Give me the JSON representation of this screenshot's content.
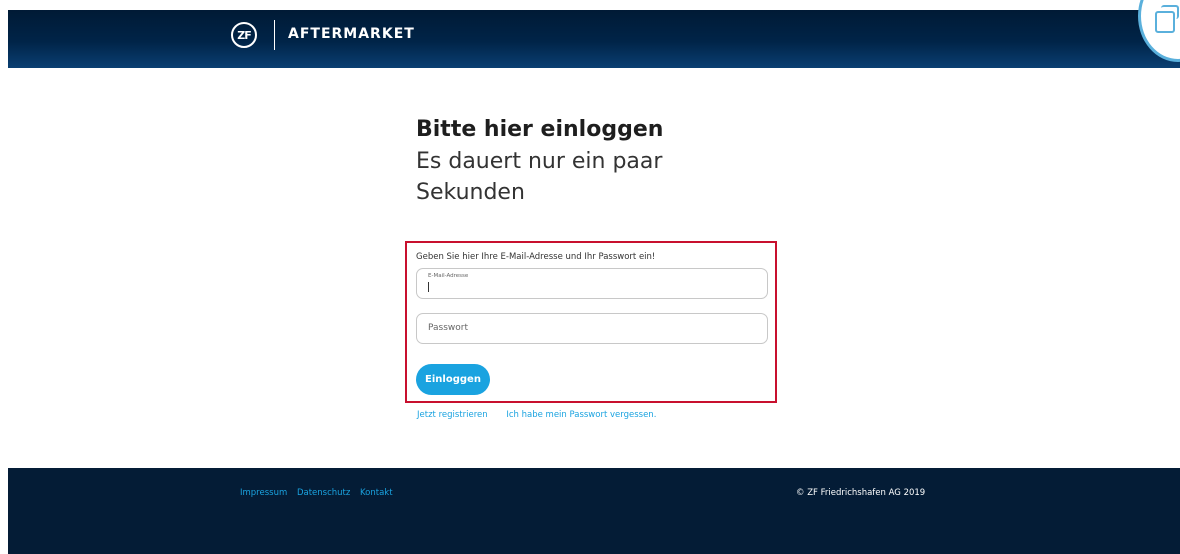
{
  "header": {
    "logo_badge": "ZF",
    "logo_text": "AFTERMARKET"
  },
  "login": {
    "title": "Bitte hier einloggen",
    "subtitle": "Es dauert nur ein paar Sekunden",
    "instruction": "Geben Sie hier Ihre E-Mail-Adresse und Ihr Passwort ein!",
    "email_label": "E-Mail-Adresse",
    "email_value": "",
    "password_placeholder": "Passwort",
    "submit_label": "Einloggen",
    "register_link": "Jetzt registrieren",
    "forgot_link": "Ich habe mein Passwort vergessen."
  },
  "footer": {
    "links": [
      "Impressum",
      "Datenschutz",
      "Kontakt"
    ],
    "copyright": "© ZF Friedrichshafen AG 2019"
  },
  "colors": {
    "accent": "#1aa3e0",
    "header_dark": "#002448",
    "footer_bg": "#041c36",
    "highlight_border": "#c8102e"
  },
  "icons": [
    "zf-logo-icon",
    "document-icon"
  ]
}
